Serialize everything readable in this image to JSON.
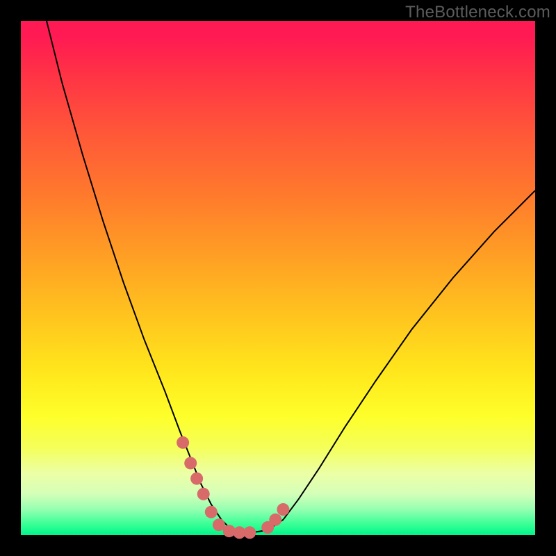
{
  "watermark": "TheBottleneck.com",
  "colors": {
    "frame": "#000000",
    "curve_stroke": "#000000",
    "marker_fill": "#d86b6a",
    "gradient_top": "#ff1a53",
    "gradient_bottom": "#00f58a"
  },
  "chart_data": {
    "type": "line",
    "title": "",
    "xlabel": "",
    "ylabel": "",
    "xlim": [
      0,
      100
    ],
    "ylim": [
      0,
      100
    ],
    "grid": false,
    "series": [
      {
        "name": "bottleneck-curve",
        "x": [
          5,
          8,
          12,
          16,
          20,
          24,
          28,
          31,
          33,
          35,
          37,
          39,
          41,
          43,
          45,
          48,
          51,
          54,
          58,
          63,
          69,
          76,
          84,
          92,
          100
        ],
        "y": [
          100,
          88,
          74,
          61,
          49,
          38,
          28,
          20,
          15,
          10,
          6,
          3,
          1,
          0.5,
          0.5,
          1,
          3,
          7,
          13,
          21,
          30,
          40,
          50,
          59,
          67
        ]
      }
    ],
    "markers": {
      "name": "highlighted-points",
      "x": [
        31.5,
        33.0,
        34.2,
        35.5,
        37.0,
        38.5,
        40.5,
        42.5,
        44.5,
        48.0,
        49.5,
        51.0
      ],
      "y": [
        18.0,
        14.0,
        11.0,
        8.0,
        4.5,
        2.0,
        0.8,
        0.5,
        0.5,
        1.5,
        3.0,
        5.0
      ]
    }
  }
}
